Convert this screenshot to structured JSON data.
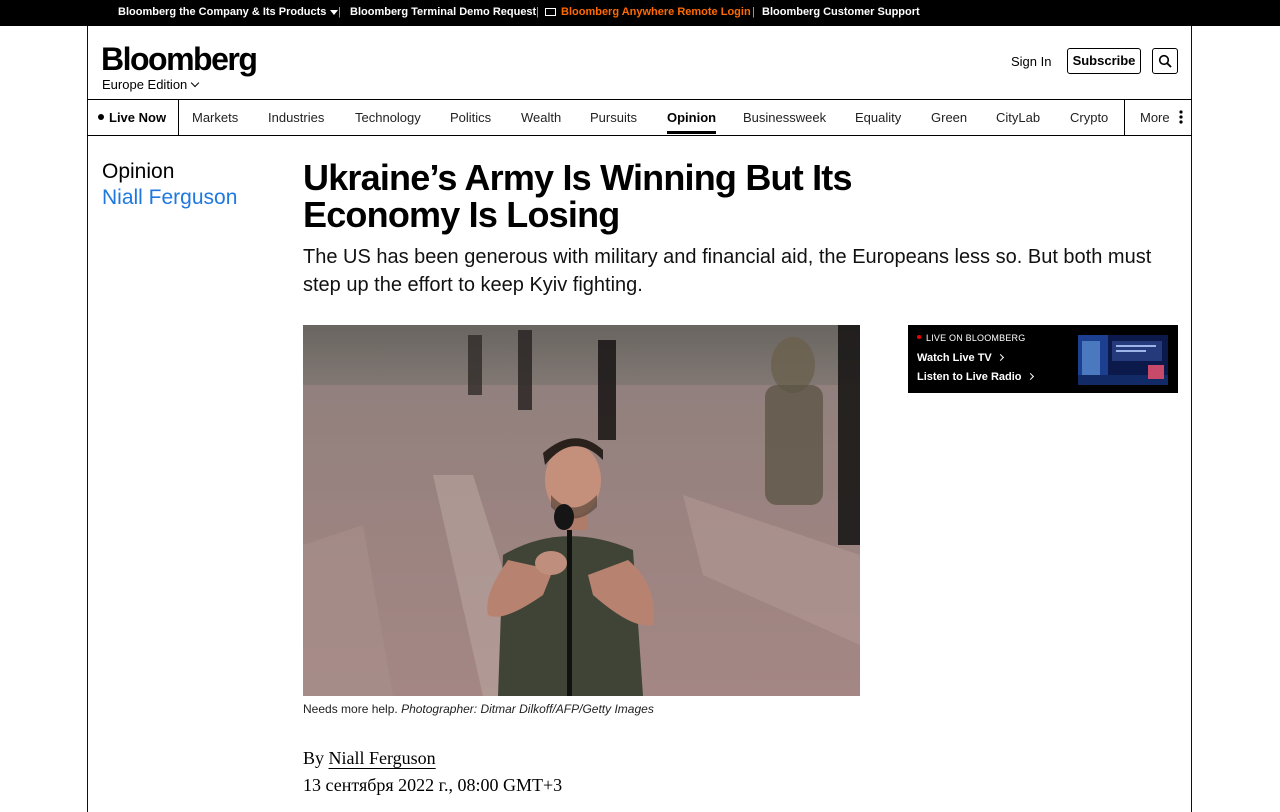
{
  "topbar": {
    "company": "Bloomberg the Company & Its Products",
    "terminal_demo": "Bloomberg Terminal Demo Request",
    "anywhere_login": "Bloomberg Anywhere Remote Login",
    "customer_support": "Bloomberg Customer Support",
    "separator": "|",
    "accent_color": "#ff6a00"
  },
  "header": {
    "logo": "Bloomberg",
    "edition": "Europe Edition",
    "sign_in": "Sign In",
    "subscribe": "Subscribe"
  },
  "nav": {
    "live_now": "Live Now",
    "items": [
      "Markets",
      "Industries",
      "Technology",
      "Politics",
      "Wealth",
      "Pursuits",
      "Opinion",
      "Businessweek",
      "Equality",
      "Green",
      "CityLab",
      "Crypto"
    ],
    "active": "Opinion",
    "more": "More"
  },
  "article": {
    "section": "Opinion",
    "columnist": "Niall Ferguson",
    "headline_line1": "Ukraine’s Army Is Winning But Its",
    "headline_line2": "Economy Is Losing",
    "dek": "The US has been generous with military and financial aid, the Europeans less so. But both must step up the effort to keep Kyiv fighting.",
    "caption_text": "Needs more help.",
    "caption_credit": "Photographer: Ditmar Dilkoff/AFP/Getty Images",
    "byline_prefix": "By",
    "byline_author": "Niall Ferguson",
    "date": "13 сентября 2022 г., 08:00 GMT+3",
    "link_color": "#1f78e0"
  },
  "live_box": {
    "title": "LIVE ON BLOOMBERG",
    "watch_tv": "Watch Live TV",
    "listen_radio": "Listen to Live Radio"
  }
}
